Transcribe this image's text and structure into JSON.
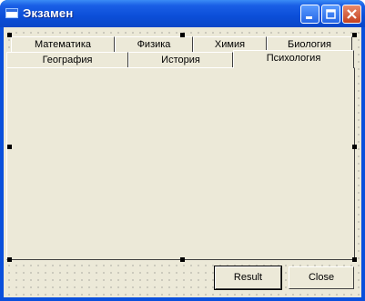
{
  "window": {
    "title": "Экзамен"
  },
  "title_buttons": {
    "minimize": "minimize-icon",
    "maximize": "maximize-icon",
    "close": "close-icon"
  },
  "tabs_row1": [
    {
      "label": "Математика"
    },
    {
      "label": "Физика"
    },
    {
      "label": "Химия"
    },
    {
      "label": "Биология"
    }
  ],
  "tabs_row2": [
    {
      "label": "География"
    },
    {
      "label": "История"
    },
    {
      "label": "Психология",
      "selected": true
    }
  ],
  "buttons": {
    "result": "Result",
    "close": "Close"
  },
  "colors": {
    "titlebar": "#0b4ed8",
    "face": "#ece9d8",
    "close_button": "#c5411e"
  }
}
